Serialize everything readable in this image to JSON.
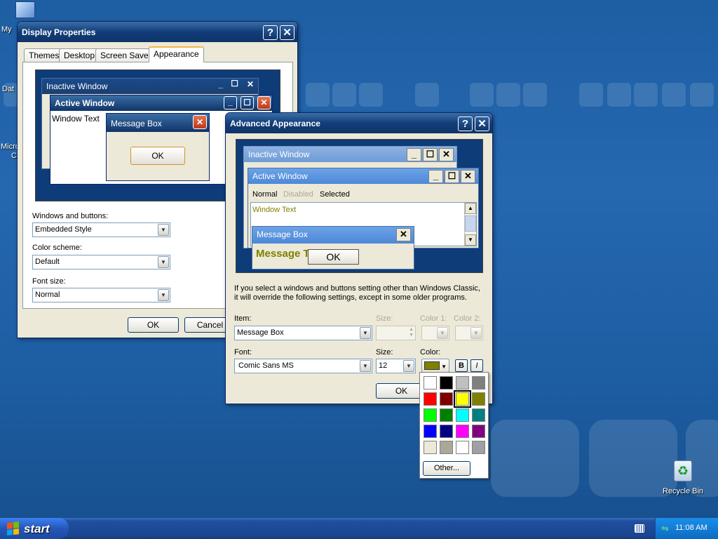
{
  "desktop": {
    "icons": [
      {
        "label": "My"
      },
      {
        "label": "Dat"
      },
      {
        "label": "Micro"
      },
      {
        "label": "C"
      },
      {
        "label": "Recycle Bin"
      }
    ]
  },
  "display_properties": {
    "title": "Display Properties",
    "tabs": [
      "Themes",
      "Desktop",
      "Screen Saver",
      "Appearance"
    ],
    "active_tab": "Appearance",
    "preview": {
      "inactive_title": "Inactive Window",
      "active_title": "Active Window",
      "window_text": "Window Text",
      "message_box_title": "Message Box",
      "ok": "OK"
    },
    "windows_buttons_label": "Windows and buttons:",
    "windows_buttons_value": "Embedded Style",
    "color_scheme_label": "Color scheme:",
    "color_scheme_value": "Default",
    "font_size_label": "Font size:",
    "font_size_value": "Normal",
    "ok_label": "OK",
    "cancel_label": "Cancel"
  },
  "advanced": {
    "title": "Advanced Appearance",
    "preview": {
      "inactive_title": "Inactive Window",
      "active_title": "Active Window",
      "menu_normal": "Normal",
      "menu_disabled": "Disabled",
      "menu_selected": "Selected",
      "window_text": "Window Text",
      "message_box_title": "Message Box",
      "message_text": "Message T",
      "ok": "OK"
    },
    "info_line1": "If you select a windows and buttons setting other than Windows Classic,",
    "info_line2": "it will override the following settings, except in some older programs.",
    "item_label": "Item:",
    "item_value": "Message Box",
    "size_label": "Size:",
    "color1_label": "Color 1:",
    "color2_label": "Color 2:",
    "font_label": "Font:",
    "font_value": "Comic Sans MS",
    "font_size_label": "Size:",
    "font_size_value": "12",
    "color_label": "Color:",
    "bold_label": "B",
    "italic_label": "I",
    "ok_label": "OK",
    "selected_color": "#808000"
  },
  "palette": {
    "colors": [
      "#ffffff",
      "#000000",
      "#c0c0c0",
      "#808080",
      "#ff0000",
      "#800000",
      "#ffff00",
      "#808000",
      "#00ff00",
      "#008000",
      "#00ffff",
      "#008080",
      "#0000ff",
      "#000080",
      "#ff00ff",
      "#800080",
      "#ece9d8",
      "#aca899",
      "#ffffff",
      "#a0a0a4"
    ],
    "selected_index": 6,
    "other_label": "Other..."
  },
  "taskbar": {
    "start_label": "start",
    "clock": "11:08 AM"
  }
}
